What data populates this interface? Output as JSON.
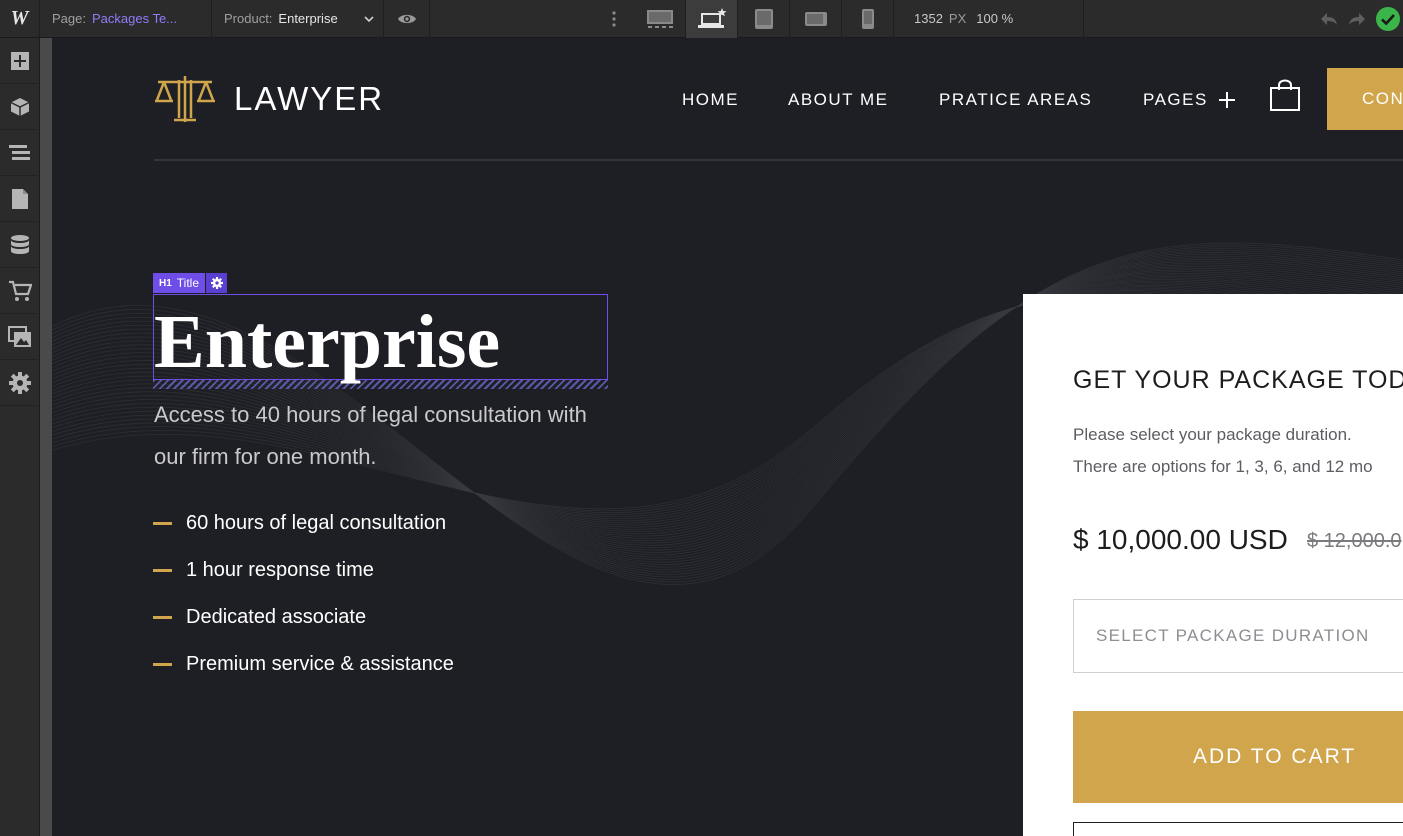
{
  "editor": {
    "page_label": "Page:",
    "page_value": "Packages Te...",
    "product_label": "Product:",
    "product_value": "Enterprise",
    "canvas_width": "1352",
    "canvas_unit": "PX",
    "zoom": "100 %"
  },
  "site": {
    "brand": "LAWYER",
    "nav": [
      "HOME",
      "ABOUT ME",
      "PRATICE AREAS",
      "PAGES"
    ],
    "contact_button": "CON"
  },
  "hero": {
    "element_tag": "H1",
    "element_label": "Title",
    "title": "Enterprise",
    "description": "Access to 40 hours of legal consultation with our firm for one month.",
    "features": [
      "60 hours of legal consultation",
      "1 hour response time",
      "Dedicated associate",
      "Premium service & assistance"
    ]
  },
  "card": {
    "title": "GET YOUR PACKAGE TOD",
    "desc_line1": "Please select your package duration.",
    "desc_line2": "There are options for 1, 3, 6, and 12 mo",
    "price": "$ 10,000.00 USD",
    "compare_price": "$ 12,000.0",
    "select_placeholder": "SELECT PACKAGE DURATION",
    "add_to_cart": "ADD TO CART"
  },
  "colors": {
    "accent_gold": "#d0a54b",
    "selection_purple": "#6f4ee8",
    "page_background": "#1e1f24"
  }
}
